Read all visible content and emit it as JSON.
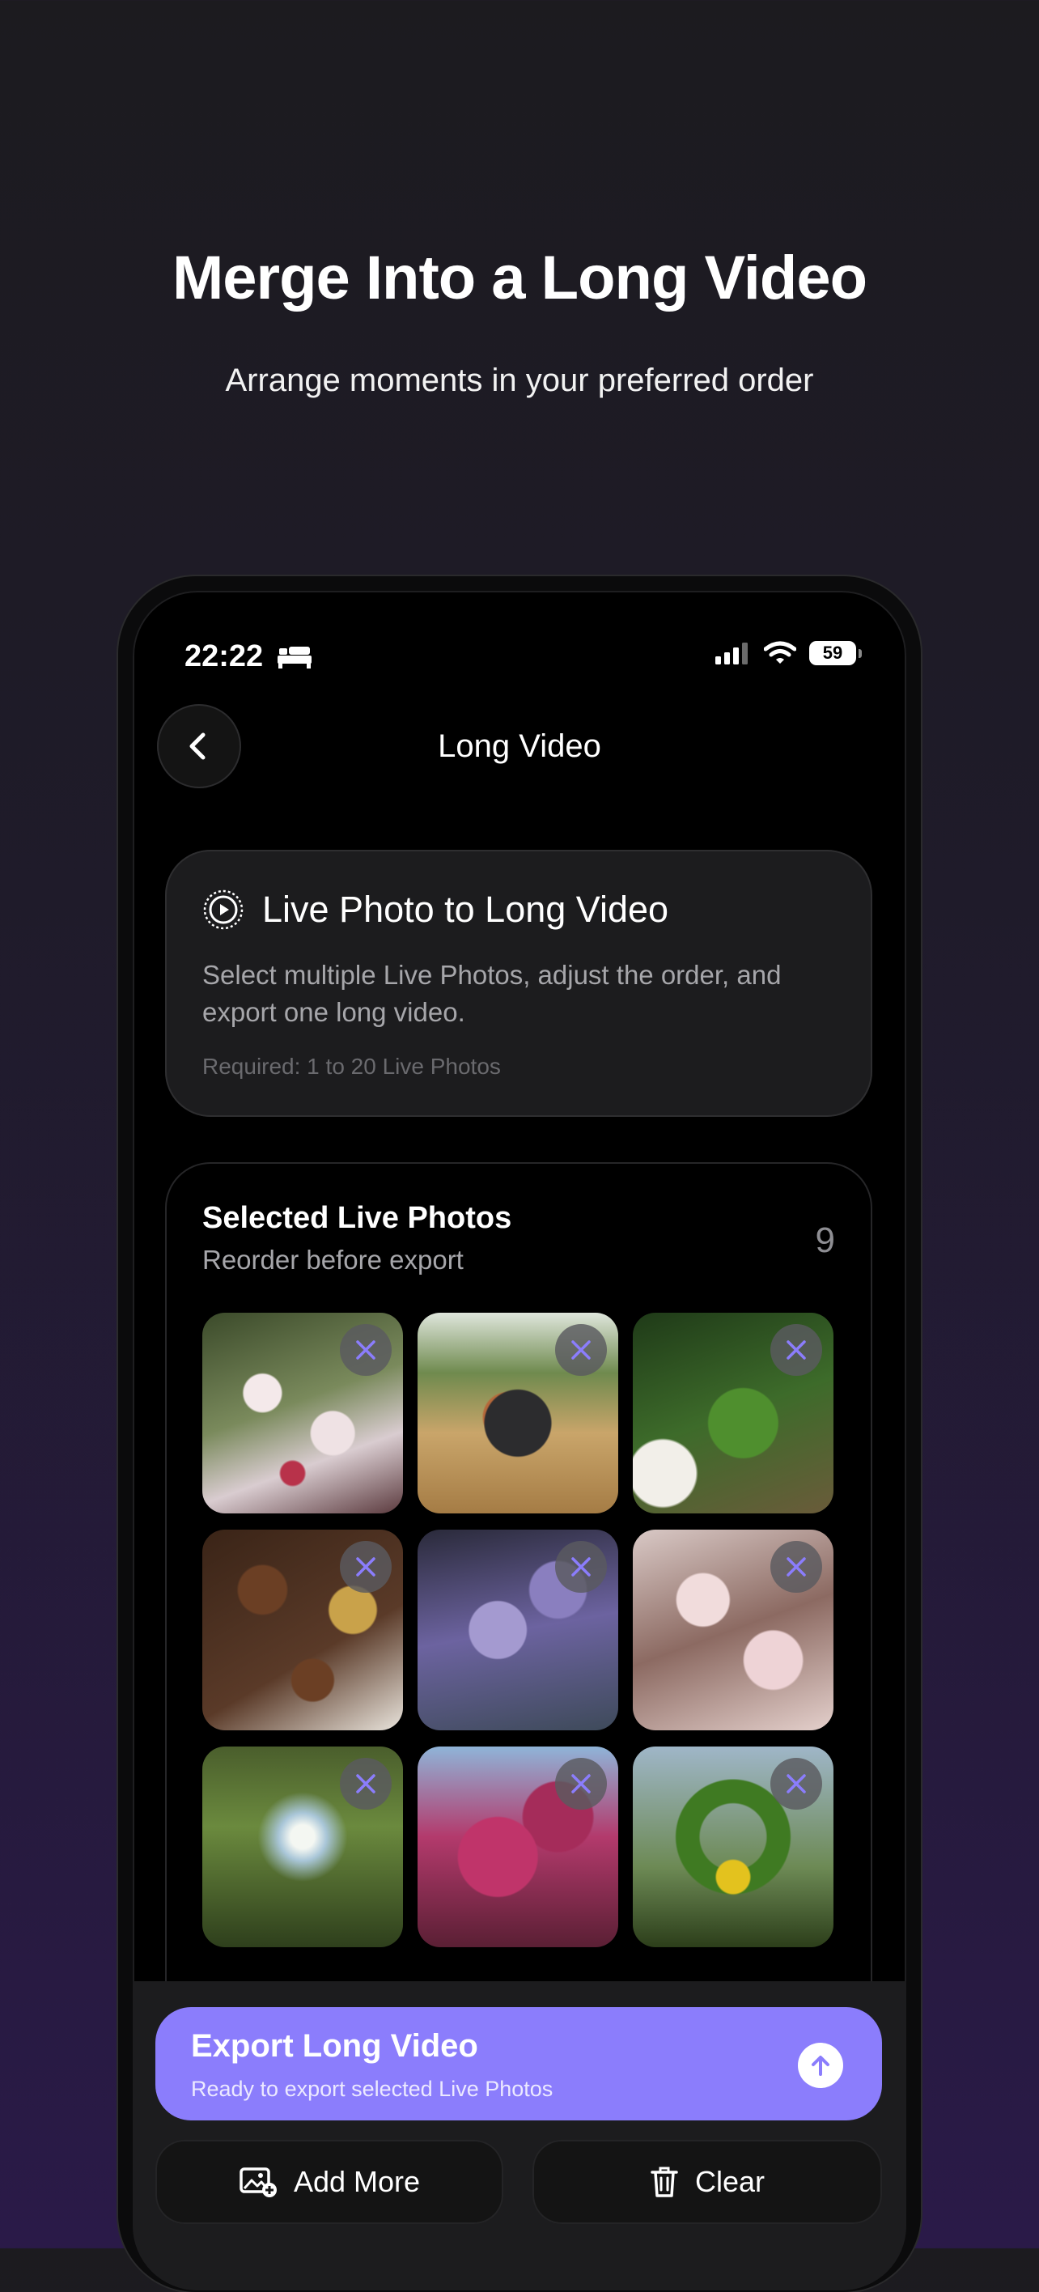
{
  "promo": {
    "headline": "Merge Into a Long Video",
    "subheadline": "Arrange moments in your preferred order"
  },
  "status_bar": {
    "time": "22:22",
    "battery_level": "59"
  },
  "nav": {
    "title": "Long Video",
    "back_icon": "chevron-left-icon"
  },
  "info_card": {
    "icon": "play-circle-icon",
    "title": "Live Photo to Long Video",
    "description": "Select multiple Live Photos, adjust the order, and export one long video.",
    "requirement": "Required: 1 to 20 Live Photos"
  },
  "selected": {
    "title": "Selected Live Photos",
    "subtitle": "Reorder before export",
    "count": "9",
    "photos": [
      {
        "subject": "white lilies"
      },
      {
        "subject": "grill picnic"
      },
      {
        "subject": "moss heart in hand"
      },
      {
        "subject": "chocolates"
      },
      {
        "subject": "wisteria"
      },
      {
        "subject": "magnolia"
      },
      {
        "subject": "tree canopy sky"
      },
      {
        "subject": "pink blossoms"
      },
      {
        "subject": "flower heart arch"
      }
    ]
  },
  "export": {
    "title": "Export Long Video",
    "subtitle": "Ready to export selected Live Photos",
    "icon": "arrow-up-circle-icon"
  },
  "actions": {
    "add_more_label": "Add More",
    "add_more_icon": "add-photo-icon",
    "clear_label": "Clear",
    "clear_icon": "trash-icon"
  },
  "colors": {
    "accent": "#8b7dfc",
    "remove_x": "#8b7dfc"
  }
}
